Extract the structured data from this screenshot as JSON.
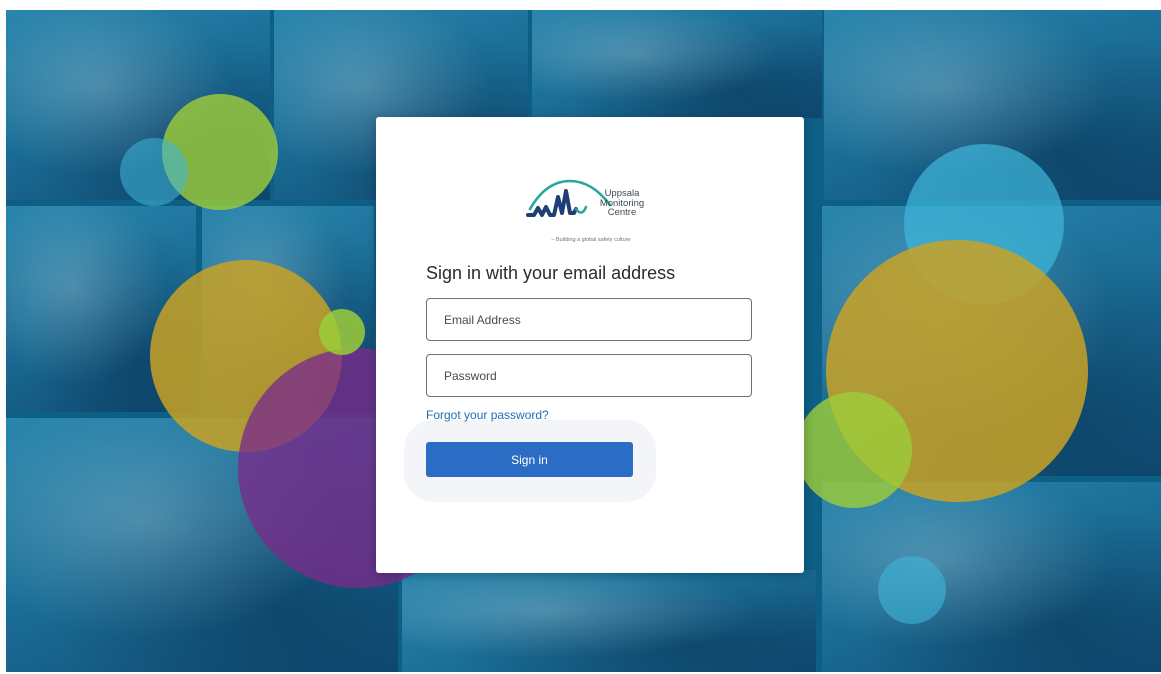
{
  "brand": {
    "name_line1": "Uppsala",
    "name_line2": "Monitoring",
    "name_line3": "Centre",
    "tagline": "– Building a global safety culture",
    "colors": {
      "logo_teal": "#2aa79b",
      "logo_blue": "#1e3f73"
    }
  },
  "signin": {
    "heading": "Sign in with your email address",
    "email_placeholder": "Email Address",
    "email_value": "",
    "password_placeholder": "Password",
    "password_value": "",
    "forgot_link": "Forgot your password?",
    "submit_label": "Sign in"
  },
  "theme": {
    "background": "#0d5f86",
    "button": "#2b6cc4",
    "link": "#1f6fb5",
    "circle_green": "#9ccc3a",
    "circle_gold": "#c9a225",
    "circle_purple": "#7a2a8a",
    "circle_cyan": "#3fb6d9"
  }
}
